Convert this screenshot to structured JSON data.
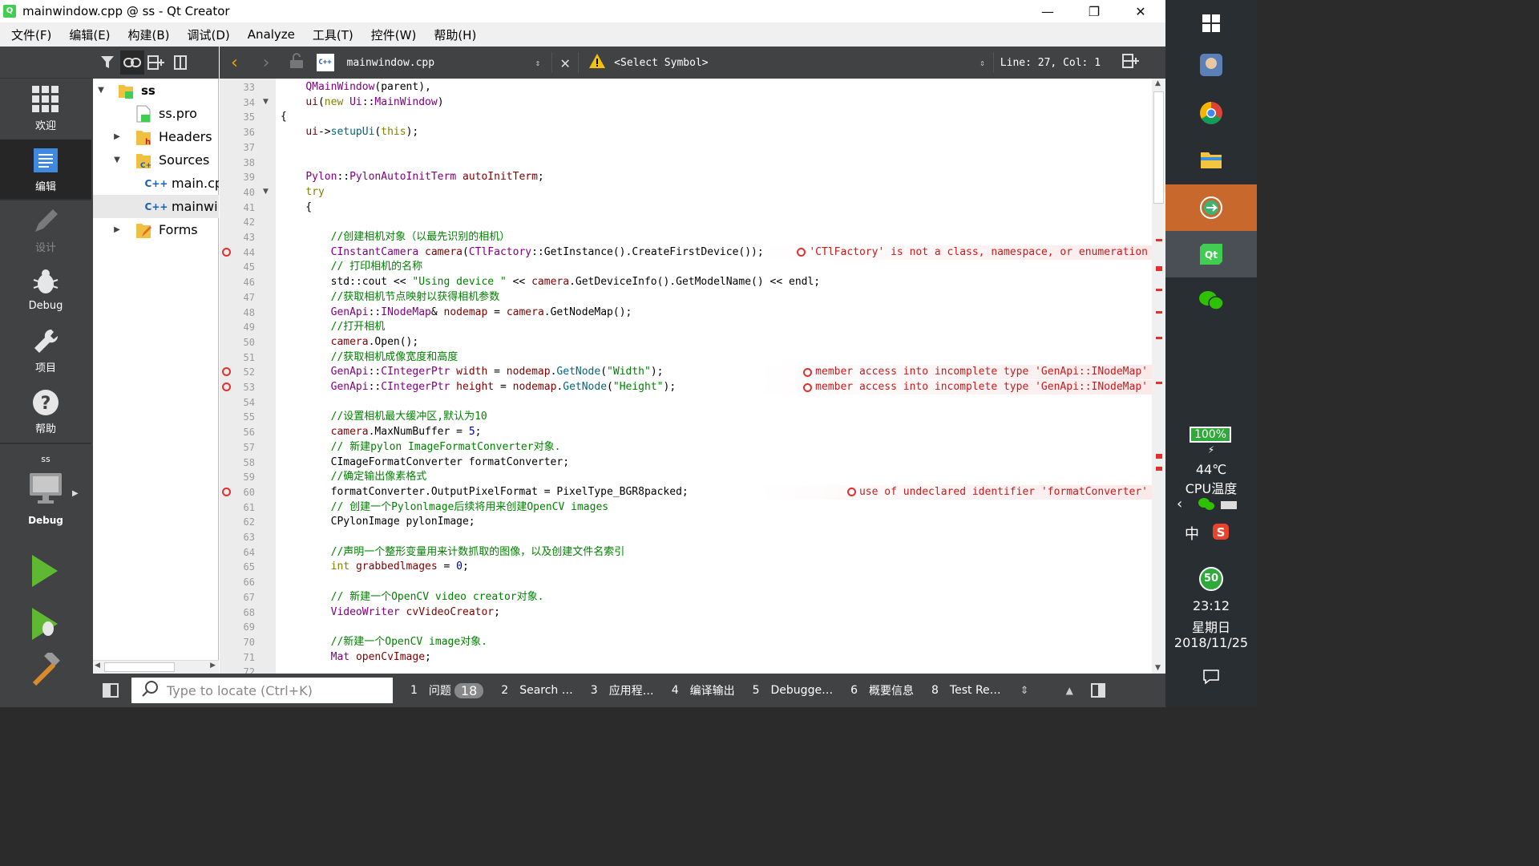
{
  "window": {
    "title": "mainwindow.cpp @ ss - Qt Creator",
    "app_icon": "qt-icon",
    "minimize": "—",
    "maximize": "❐",
    "close": "✕"
  },
  "menu": [
    "文件(F)",
    "编辑(E)",
    "构建(B)",
    "调试(D)",
    "Analyze",
    "工具(T)",
    "控件(W)",
    "帮助(H)"
  ],
  "modes": [
    {
      "label": "欢迎",
      "icon": "grid-icon",
      "active": false,
      "enabled": true
    },
    {
      "label": "编辑",
      "icon": "edit-doc-icon",
      "active": true,
      "enabled": true
    },
    {
      "label": "设计",
      "icon": "pencil-icon",
      "active": false,
      "enabled": false
    },
    {
      "label": "Debug",
      "icon": "bug-icon",
      "active": false,
      "enabled": true
    },
    {
      "label": "项目",
      "icon": "wrench-icon",
      "active": false,
      "enabled": true
    },
    {
      "label": "帮助",
      "icon": "help-icon",
      "active": false,
      "enabled": true
    }
  ],
  "kit": {
    "project": "ss",
    "config": "Debug"
  },
  "tree": [
    {
      "label": "ss",
      "icon": "qt-project-icon",
      "level": 0,
      "arrow": "▼",
      "bold": true
    },
    {
      "label": "ss.pro",
      "icon": "pro-file-icon",
      "level": 1,
      "arrow": ""
    },
    {
      "label": "Headers",
      "icon": "headers-folder-icon",
      "level": 1,
      "arrow": "▶"
    },
    {
      "label": "Sources",
      "icon": "sources-folder-icon",
      "level": 1,
      "arrow": "▼"
    },
    {
      "label": "main.cpp",
      "icon": "cpp-file-icon",
      "level": 2,
      "arrow": ""
    },
    {
      "label": "mainwindow.cpp",
      "icon": "cpp-file-icon",
      "level": 2,
      "arrow": "",
      "selected": true
    },
    {
      "label": "Forms",
      "icon": "forms-folder-icon",
      "level": 1,
      "arrow": "▶"
    }
  ],
  "editor_toolbar": {
    "file": "mainwindow.cpp",
    "symbol": "<Select Symbol>",
    "position": "Line: 27, Col: 1"
  },
  "code_lines": [
    {
      "n": "33",
      "fold": "",
      "text": "    QMainWindow(parent),"
    },
    {
      "n": "34",
      "fold": "▼",
      "text": "    ui(new Ui::MainWindow)"
    },
    {
      "n": "35",
      "fold": "",
      "text": "{"
    },
    {
      "n": "36",
      "fold": "",
      "text": "    ui->setupUi(this);"
    },
    {
      "n": "37",
      "fold": "",
      "text": ""
    },
    {
      "n": "38",
      "fold": "",
      "text": ""
    },
    {
      "n": "39",
      "fold": "",
      "text": "    Pylon::PylonAutoInitTerm autoInitTerm;"
    },
    {
      "n": "40",
      "fold": "▼",
      "text": "    try"
    },
    {
      "n": "41",
      "fold": "",
      "text": "    {"
    },
    {
      "n": "42",
      "fold": "",
      "text": ""
    },
    {
      "n": "43",
      "fold": "",
      "text": "        //创建相机对象（以最先识别的相机）"
    },
    {
      "n": "44",
      "fold": "",
      "text": "        CInstantCamera camera(CTlFactory::GetInstance().CreateFirstDevice());",
      "error": "'CTlFactory' is not a class, namespace, or enumeration"
    },
    {
      "n": "45",
      "fold": "",
      "text": "        // 打印相机的名称"
    },
    {
      "n": "46",
      "fold": "",
      "text": "        std::cout << \"Using device \" << camera.GetDeviceInfo().GetModelName() << endl;"
    },
    {
      "n": "47",
      "fold": "",
      "text": "        //获取相机节点映射以获得相机参数"
    },
    {
      "n": "48",
      "fold": "",
      "text": "        GenApi::INodeMap& nodemap = camera.GetNodeMap();"
    },
    {
      "n": "49",
      "fold": "",
      "text": "        //打开相机"
    },
    {
      "n": "50",
      "fold": "",
      "text": "        camera.Open();"
    },
    {
      "n": "51",
      "fold": "",
      "text": "        //获取相机成像宽度和高度"
    },
    {
      "n": "52",
      "fold": "",
      "text": "        GenApi::CIntegerPtr width = nodemap.GetNode(\"Width\");",
      "error": "member access into incomplete type 'GenApi::INodeMap'"
    },
    {
      "n": "53",
      "fold": "",
      "text": "        GenApi::CIntegerPtr height = nodemap.GetNode(\"Height\");",
      "error": "member access into incomplete type 'GenApi::INodeMap'"
    },
    {
      "n": "54",
      "fold": "",
      "text": ""
    },
    {
      "n": "55",
      "fold": "",
      "text": "        //设置相机最大缓冲区,默认为10"
    },
    {
      "n": "56",
      "fold": "",
      "text": "        camera.MaxNumBuffer = 5;"
    },
    {
      "n": "57",
      "fold": "",
      "text": "        // 新建pylon ImageFormatConverter对象."
    },
    {
      "n": "58",
      "fold": "",
      "text": "        CImageFormatConverter formatConverter;"
    },
    {
      "n": "59",
      "fold": "",
      "text": "        //确定输出像素格式"
    },
    {
      "n": "60",
      "fold": "",
      "text": "        formatConverter.OutputPixelFormat = PixelType_BGR8packed;",
      "error": "use of undeclared identifier 'formatConverter'"
    },
    {
      "n": "61",
      "fold": "",
      "text": "        // 创建一个Pylonlmage后续将用来创建OpenCV images"
    },
    {
      "n": "62",
      "fold": "",
      "text": "        CPylonImage pylonImage;"
    },
    {
      "n": "63",
      "fold": "",
      "text": ""
    },
    {
      "n": "64",
      "fold": "",
      "text": "        //声明一个整形变量用来计数抓取的图像，以及创建文件名索引"
    },
    {
      "n": "65",
      "fold": "",
      "text": "        int grabbedlmages = 0;"
    },
    {
      "n": "66",
      "fold": "",
      "text": ""
    },
    {
      "n": "67",
      "fold": "",
      "text": "        // 新建一个OpenCV video creator对象."
    },
    {
      "n": "68",
      "fold": "",
      "text": "        VideoWriter cvVideoCreator;"
    },
    {
      "n": "69",
      "fold": "",
      "text": ""
    },
    {
      "n": "70",
      "fold": "",
      "text": "        //新建一个OpenCV image对象."
    },
    {
      "n": "71",
      "fold": "",
      "text": "        Mat openCvImage;"
    },
    {
      "n": "72",
      "fold": "",
      "text": ""
    }
  ],
  "output_bar": {
    "locator_placeholder": "Type to locate (Ctrl+K)",
    "tabs": [
      {
        "num": "1",
        "label": "问题",
        "badge": "18"
      },
      {
        "num": "2",
        "label": "Search …"
      },
      {
        "num": "3",
        "label": "应用程…"
      },
      {
        "num": "4",
        "label": "编译输出"
      },
      {
        "num": "5",
        "label": "Debugge…"
      },
      {
        "num": "6",
        "label": "概要信息"
      },
      {
        "num": "8",
        "label": "Test Re…"
      }
    ]
  },
  "taskbar": {
    "battery": "100%",
    "temp": "44℃",
    "temp_label": "CPU温度",
    "ime": "中",
    "badge": "50",
    "time": "23:12",
    "weekday": "星期日",
    "date": "2018/11/25",
    "colors": {
      "qt_green": "#41cd52",
      "error_red": "#e0312e",
      "active_orange": "#c9682c"
    }
  }
}
